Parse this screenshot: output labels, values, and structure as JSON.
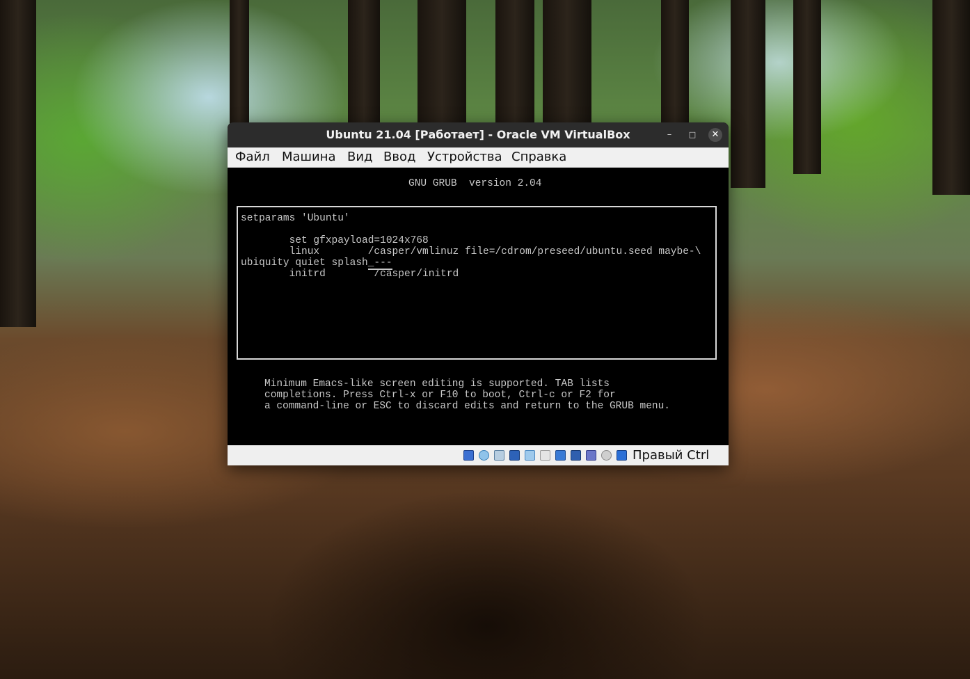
{
  "window": {
    "title": "Ubuntu 21.04 [Работает] - Oracle VM VirtualBox",
    "minimize_glyph": "–",
    "maximize_glyph": "□",
    "close_glyph": "✕"
  },
  "menubar": {
    "items": [
      "Файл",
      "Машина",
      "Вид",
      "Ввод",
      "Устройства",
      "Справка"
    ]
  },
  "grub": {
    "header": "GNU GRUB  version 2.04",
    "lines": [
      "setparams 'Ubuntu'",
      "",
      "        set gfxpayload=1024x768",
      "        linux        /casper/vmlinuz file=/cdrom/preseed/ubuntu.seed maybe-\\",
      "ubiquity quiet splash",
      "        initrd        /casper/initrd"
    ],
    "cursor_text": "_---",
    "help": [
      "Minimum Emacs-like screen editing is supported. TAB lists",
      "completions. Press Ctrl-x or F10 to boot, Ctrl-c or F2 for",
      "a command-line or ESC to discard edits and return to the GRUB menu."
    ]
  },
  "statusbar": {
    "icons": [
      "hard-disk-icon",
      "optical-drive-icon",
      "audio-icon",
      "network-icon",
      "usb-icon",
      "shared-folders-icon",
      "display-icon",
      "video-capture-icon",
      "virtualization-icon",
      "mouse-integration-icon",
      "keyboard-capture-icon"
    ],
    "host_key": "Правый Ctrl"
  }
}
